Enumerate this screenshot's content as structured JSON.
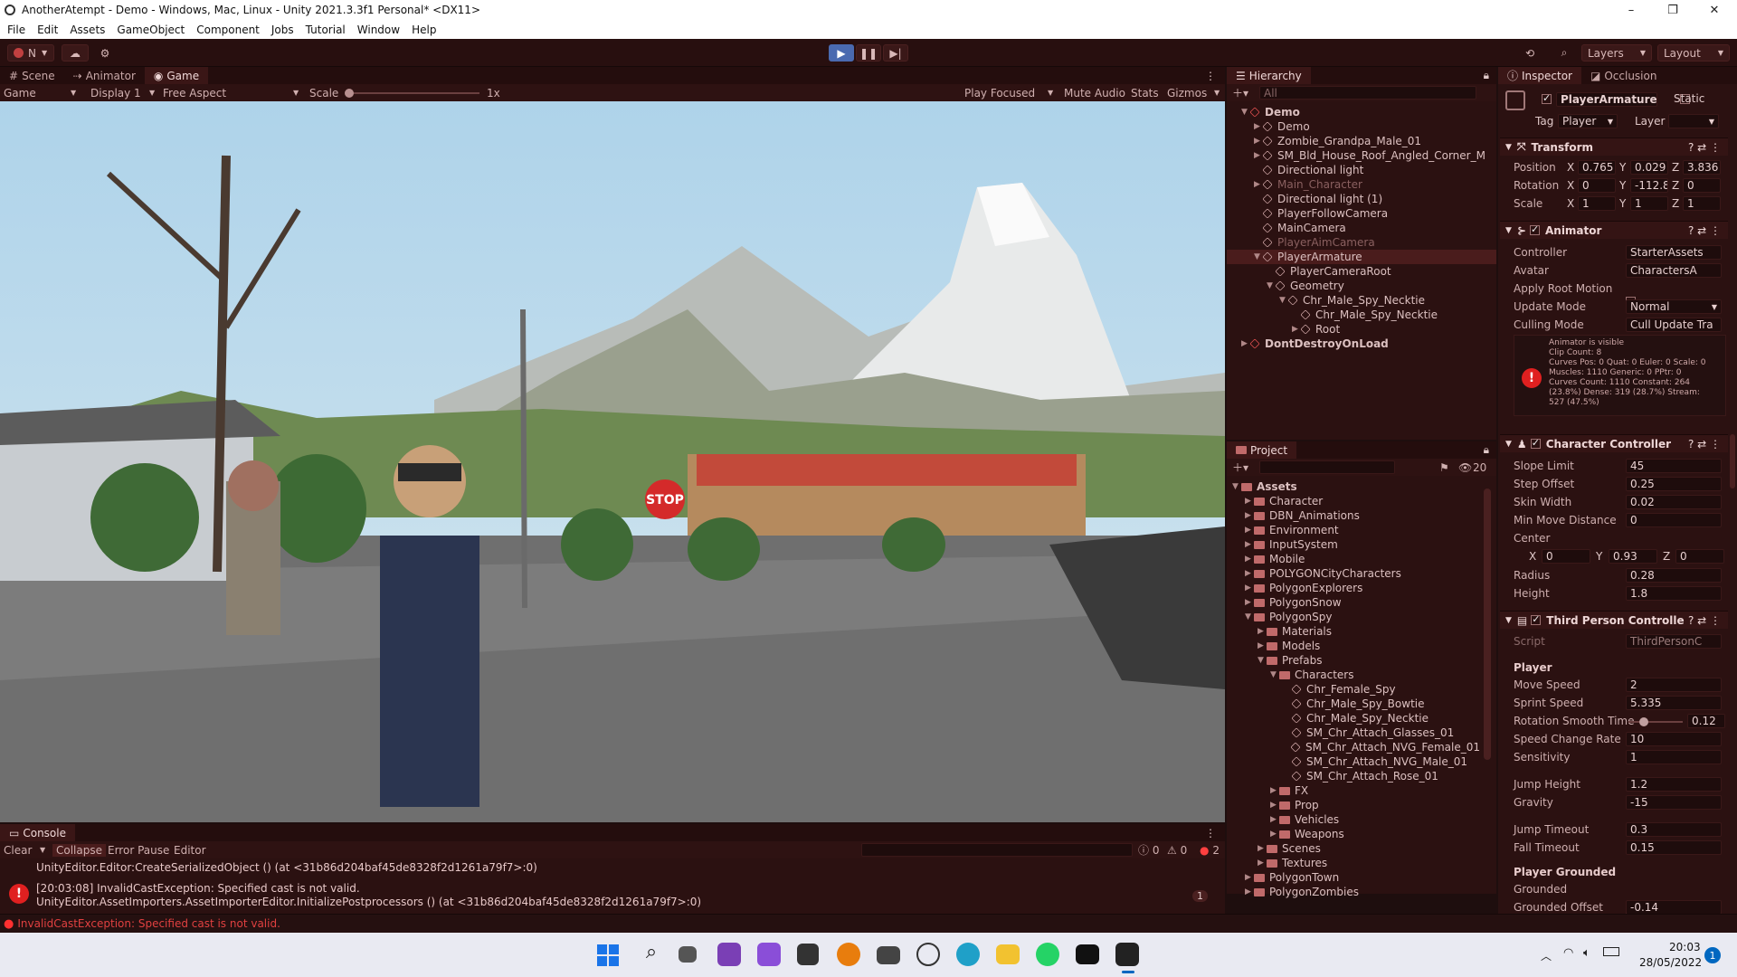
{
  "window": {
    "title": "AnotherAtempt - Demo - Windows, Mac, Linux - Unity 2021.3.3f1 Personal* <DX11>"
  },
  "menu": [
    "File",
    "Edit",
    "Assets",
    "GameObject",
    "Component",
    "Jobs",
    "Tutorial",
    "Window",
    "Help"
  ],
  "toolbar": {
    "account": "N",
    "layers": "Layers",
    "layout": "Layout"
  },
  "scene_tabs": [
    "Scene",
    "Animator",
    "Game"
  ],
  "game_bar": {
    "display_mode": "Game",
    "display": "Display 1",
    "aspect": "Free Aspect",
    "scale_label": "Scale",
    "scale_value": "1x",
    "play_focused": "Play Focused",
    "mute": "Mute Audio",
    "stats": "Stats",
    "gizmos": "Gizmos"
  },
  "hierarchy": {
    "title": "Hierarchy",
    "search_placeholder": "All",
    "rows": [
      {
        "label": "Demo",
        "indent": 0,
        "kind": "scene",
        "arrow": "▼"
      },
      {
        "label": "Demo",
        "indent": 1,
        "kind": "obj",
        "arrow": "▶"
      },
      {
        "label": "Zombie_Grandpa_Male_01",
        "indent": 1,
        "kind": "obj",
        "arrow": "▶"
      },
      {
        "label": "SM_Bld_House_Roof_Angled_Corner_M",
        "indent": 1,
        "kind": "obj",
        "arrow": "▶"
      },
      {
        "label": "Directional light",
        "indent": 1,
        "kind": "obj",
        "arrow": ""
      },
      {
        "label": "Main_Character",
        "indent": 1,
        "kind": "obj",
        "arrow": "▶",
        "dim": true
      },
      {
        "label": "Directional light (1)",
        "indent": 1,
        "kind": "obj",
        "arrow": ""
      },
      {
        "label": "PlayerFollowCamera",
        "indent": 1,
        "kind": "obj",
        "arrow": ""
      },
      {
        "label": "MainCamera",
        "indent": 1,
        "kind": "obj",
        "arrow": ""
      },
      {
        "label": "PlayerAimCamera",
        "indent": 1,
        "kind": "obj",
        "arrow": "",
        "dim": true
      },
      {
        "label": "PlayerArmature",
        "indent": 1,
        "kind": "obj",
        "arrow": "▼",
        "sel": true
      },
      {
        "label": "PlayerCameraRoot",
        "indent": 2,
        "kind": "obj",
        "arrow": ""
      },
      {
        "label": "Geometry",
        "indent": 2,
        "kind": "obj",
        "arrow": "▼"
      },
      {
        "label": "Chr_Male_Spy_Necktie",
        "indent": 3,
        "kind": "obj",
        "arrow": "▼"
      },
      {
        "label": "Chr_Male_Spy_Necktie",
        "indent": 4,
        "kind": "obj",
        "arrow": ""
      },
      {
        "label": "Root",
        "indent": 4,
        "kind": "obj",
        "arrow": "▶"
      },
      {
        "label": "DontDestroyOnLoad",
        "indent": 0,
        "kind": "scene",
        "arrow": "▶"
      }
    ]
  },
  "project": {
    "title": "Project",
    "hidden_count": "20",
    "rows": [
      {
        "label": "Assets",
        "indent": 0,
        "arrow": "▼",
        "kind": "folder",
        "bold": true
      },
      {
        "label": "Character",
        "indent": 1,
        "arrow": "▶",
        "kind": "folder"
      },
      {
        "label": "DBN_Animations",
        "indent": 1,
        "arrow": "▶",
        "kind": "folder"
      },
      {
        "label": "Environment",
        "indent": 1,
        "arrow": "▶",
        "kind": "folder"
      },
      {
        "label": "InputSystem",
        "indent": 1,
        "arrow": "▶",
        "kind": "folder"
      },
      {
        "label": "Mobile",
        "indent": 1,
        "arrow": "▶",
        "kind": "folder"
      },
      {
        "label": "POLYGONCityCharacters",
        "indent": 1,
        "arrow": "▶",
        "kind": "folder"
      },
      {
        "label": "PolygonExplorers",
        "indent": 1,
        "arrow": "▶",
        "kind": "folder"
      },
      {
        "label": "PolygonSnow",
        "indent": 1,
        "arrow": "▶",
        "kind": "folder"
      },
      {
        "label": "PolygonSpy",
        "indent": 1,
        "arrow": "▼",
        "kind": "folder"
      },
      {
        "label": "Materials",
        "indent": 2,
        "arrow": "▶",
        "kind": "folder"
      },
      {
        "label": "Models",
        "indent": 2,
        "arrow": "▶",
        "kind": "folder"
      },
      {
        "label": "Prefabs",
        "indent": 2,
        "arrow": "▼",
        "kind": "folder"
      },
      {
        "label": "Characters",
        "indent": 3,
        "arrow": "▼",
        "kind": "folder"
      },
      {
        "label": "Chr_Female_Spy",
        "indent": 4,
        "arrow": "",
        "kind": "prefab"
      },
      {
        "label": "Chr_Male_Spy_Bowtie",
        "indent": 4,
        "arrow": "",
        "kind": "prefab"
      },
      {
        "label": "Chr_Male_Spy_Necktie",
        "indent": 4,
        "arrow": "",
        "kind": "prefab"
      },
      {
        "label": "SM_Chr_Attach_Glasses_01",
        "indent": 4,
        "arrow": "",
        "kind": "prefab"
      },
      {
        "label": "SM_Chr_Attach_NVG_Female_01",
        "indent": 4,
        "arrow": "",
        "kind": "prefab"
      },
      {
        "label": "SM_Chr_Attach_NVG_Male_01",
        "indent": 4,
        "arrow": "",
        "kind": "prefab"
      },
      {
        "label": "SM_Chr_Attach_Rose_01",
        "indent": 4,
        "arrow": "",
        "kind": "prefab"
      },
      {
        "label": "FX",
        "indent": 3,
        "arrow": "▶",
        "kind": "folder"
      },
      {
        "label": "Prop",
        "indent": 3,
        "arrow": "▶",
        "kind": "folder"
      },
      {
        "label": "Vehicles",
        "indent": 3,
        "arrow": "▶",
        "kind": "folder"
      },
      {
        "label": "Weapons",
        "indent": 3,
        "arrow": "▶",
        "kind": "folder"
      },
      {
        "label": "Scenes",
        "indent": 2,
        "arrow": "▶",
        "kind": "folder"
      },
      {
        "label": "Textures",
        "indent": 2,
        "arrow": "▶",
        "kind": "folder"
      },
      {
        "label": "PolygonTown",
        "indent": 1,
        "arrow": "▶",
        "kind": "folder"
      },
      {
        "label": "PolygonZombies",
        "indent": 1,
        "arrow": "▶",
        "kind": "folder"
      }
    ]
  },
  "inspector": {
    "tabs": [
      "Inspector",
      "Occlusion"
    ],
    "object_name": "PlayerArmature",
    "static_label": "Static",
    "tag_label": "Tag",
    "tag_value": "Player",
    "layer_label": "Layer",
    "layer_value": "",
    "transform": {
      "title": "Transform",
      "position": {
        "label": "Position",
        "x": "0.765",
        "y": "0.029",
        "z": "3.836"
      },
      "rotation": {
        "label": "Rotation",
        "x": "0",
        "y": "-112.8",
        "z": "0"
      },
      "scale": {
        "label": "Scale",
        "x": "1",
        "y": "1",
        "z": "1"
      }
    },
    "animator": {
      "title": "Animator",
      "controller_label": "Controller",
      "controller": "StarterAssets",
      "avatar_label": "Avatar",
      "avatar": "CharactersA",
      "root_motion_label": "Apply Root Motion",
      "update_mode_label": "Update Mode",
      "update_mode": "Normal",
      "culling_label": "Culling Mode",
      "culling": "Cull Update Tra",
      "info": [
        "Animator is visible",
        "Clip Count: 8",
        "Curves Pos: 0 Quat: 0 Euler: 0 Scale: 0",
        "Muscles: 1110 Generic: 0 PPtr: 0",
        "Curves Count: 1110 Constant: 264",
        "(23.8%) Dense: 319 (28.7%) Stream:",
        "527 (47.5%)"
      ]
    },
    "character_controller": {
      "title": "Character Controller",
      "fields": [
        {
          "label": "Slope Limit",
          "value": "45"
        },
        {
          "label": "Step Offset",
          "value": "0.25"
        },
        {
          "label": "Skin Width",
          "value": "0.02"
        },
        {
          "label": "Min Move Distance",
          "value": "0"
        }
      ],
      "center_label": "Center",
      "center": {
        "x": "0",
        "y": "0.93",
        "z": "0"
      },
      "radius_label": "Radius",
      "radius": "0.28",
      "height_label": "Height",
      "height": "1.8"
    },
    "third_person": {
      "title": "Third Person Controlle",
      "script_label": "Script",
      "script": "ThirdPersonC",
      "player_header": "Player",
      "fields": [
        {
          "label": "Move Speed",
          "value": "2"
        },
        {
          "label": "Sprint Speed",
          "value": "5.335"
        },
        {
          "label": "Rotation Smooth Time",
          "value": "0.12"
        },
        {
          "label": "Speed Change Rate",
          "value": "10"
        },
        {
          "label": "Sensitivity",
          "value": "1"
        },
        {
          "label": "Jump Height",
          "value": "1.2"
        },
        {
          "label": "Gravity",
          "value": "-15"
        },
        {
          "label": "Jump Timeout",
          "value": "0.3"
        },
        {
          "label": "Fall Timeout",
          "value": "0.15"
        }
      ],
      "grounded_header": "Player Grounded",
      "grounded_label": "Grounded",
      "grounded_offset_label": "Grounded Offset",
      "grounded_offset": "-0.14"
    }
  },
  "console": {
    "title": "Console",
    "clear": "Clear",
    "collapse": "Collapse",
    "error_pause": "Error Pause",
    "editor": "Editor",
    "counts": {
      "info": "0",
      "warn": "0",
      "error": "2"
    },
    "line0": "UnityEditor.Editor:CreateSerializedObject () (at <31b86d204baf45de8328f2d1261a79f7>:0)",
    "entry_time": "[20:03:08] InvalidCastException: Specified cast is not valid.",
    "entry_stack": "UnityEditor.AssetImporters.AssetImporterEditor.InitializePostprocessors () (at <31b86d204baf45de8328f2d1261a79f7>:0)",
    "entry_count": "1",
    "status": "InvalidCastException: Specified cast is not valid."
  },
  "taskbar": {
    "time": "20:03",
    "date": "28/05/2022",
    "notif": "1"
  },
  "colors": {
    "accent": "#e02020",
    "panel": "#2b1111",
    "header": "#341414"
  }
}
